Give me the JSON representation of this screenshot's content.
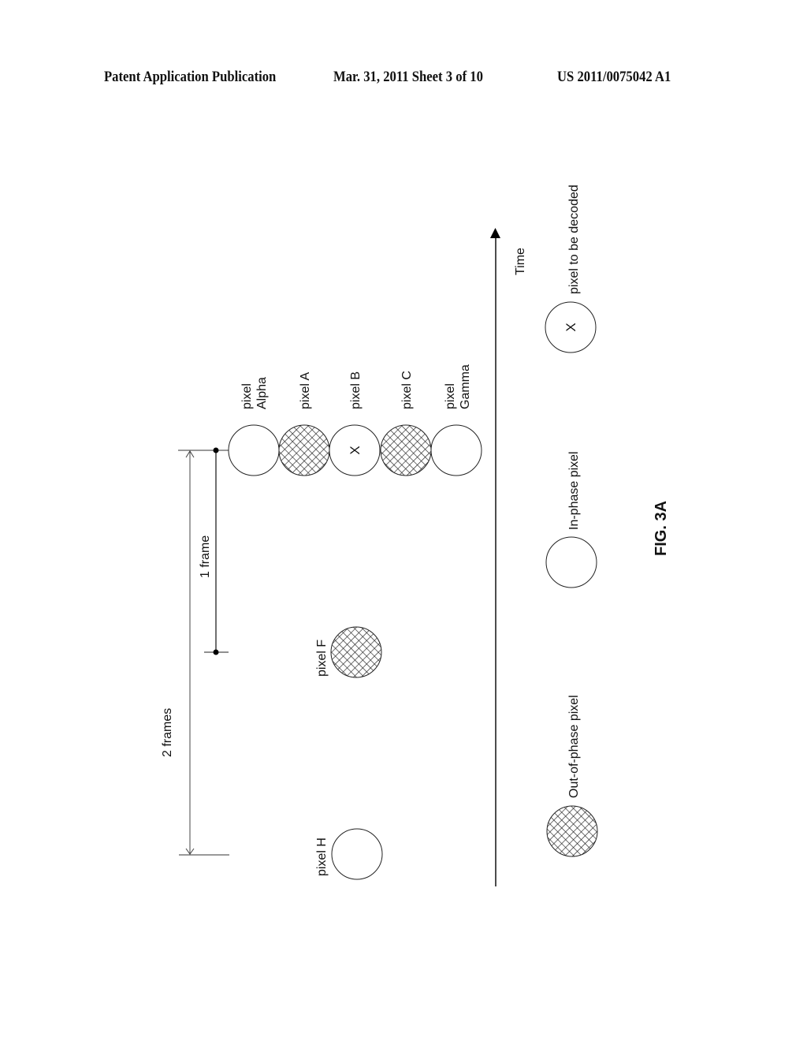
{
  "header": {
    "left": "Patent Application Publication",
    "middle": "Mar. 31, 2011  Sheet 3 of 10",
    "right": "US 2011/0075042 A1"
  },
  "figure": {
    "caption": "FIG. 3A",
    "time_axis_label": "Time",
    "dimension_1_frame": "1   frame",
    "dimension_2_frames": "2   frames",
    "row_pixels": [
      {
        "line1": "pixel",
        "line2": "Alpha",
        "type": "in-phase",
        "marked": false
      },
      {
        "line1": "pixel  A",
        "line2": "",
        "type": "out-of-phase",
        "marked": false
      },
      {
        "line1": "pixel  B",
        "line2": "",
        "type": "in-phase",
        "marked": true
      },
      {
        "line1": "pixel  C",
        "line2": "",
        "type": "out-of-phase",
        "marked": false
      },
      {
        "line1": "pixel",
        "line2": "Gamma",
        "type": "in-phase",
        "marked": false
      }
    ],
    "pixel_f": {
      "label": "pixel F",
      "type": "out-of-phase"
    },
    "pixel_h": {
      "label": "pixel H",
      "type": "in-phase"
    },
    "x_mark": "X",
    "legend": [
      {
        "label": "pixel to be decoded",
        "type": "to-be-decoded"
      },
      {
        "label": "In-phase pixel",
        "type": "in-phase"
      },
      {
        "label": "Out-of-phase pixel",
        "type": "out-of-phase"
      }
    ]
  }
}
